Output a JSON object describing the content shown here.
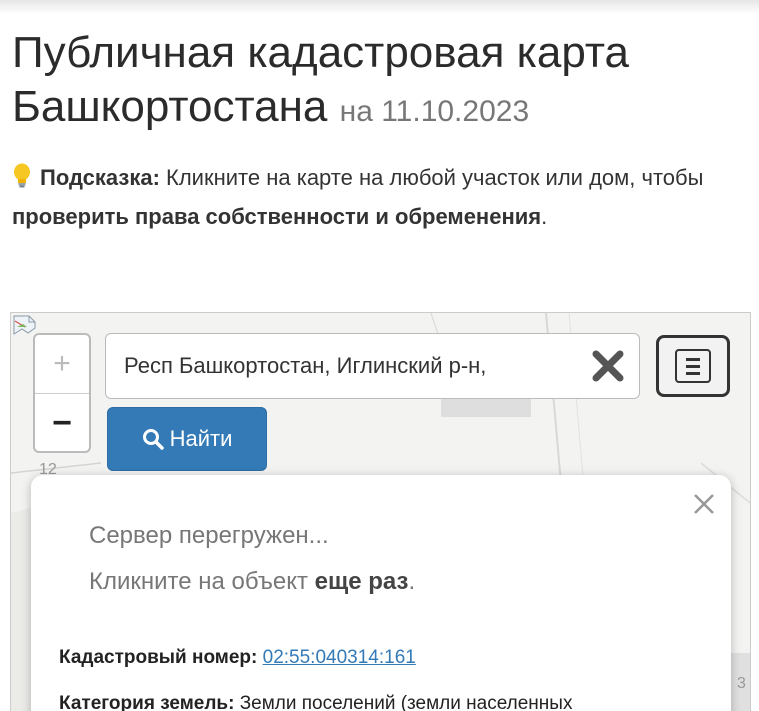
{
  "header": {
    "title": "Публичная кадастровая карта Башкортостана",
    "date": "на 11.10.2023"
  },
  "hint": {
    "icon": "lightbulb-icon",
    "label": "Подсказка:",
    "text1": "Кликните на карте на любой участок или дом, чтобы",
    "emphasis": "проверить права собственности и обременения",
    "end": "."
  },
  "map": {
    "zoom_in": "+",
    "zoom_out": "−",
    "search_value": "Респ Башкортостан, Иглинский р-н,",
    "find_label": "Найти",
    "label_left": "12",
    "label_right": "3"
  },
  "popup": {
    "status1": "Сервер перегружен...",
    "status2_prefix": "Кликните на объект",
    "status2_bold": "еще раз",
    "status2_suffix": ".",
    "cadastral_label": "Кадастровый номер:",
    "cadastral_value": "02:55:040314:161",
    "category_label": "Категория земель:",
    "category_value": "Земли поселений (земли населенных"
  },
  "colors": {
    "accent": "#337ab7",
    "text": "#2b2b2b",
    "muted": "#777777"
  }
}
